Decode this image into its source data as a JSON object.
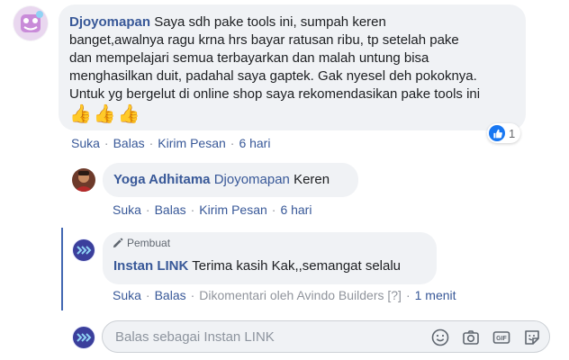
{
  "comments": [
    {
      "author": "Djoyomapan",
      "lines": [
        "Saya sdh pake tools ini, sumpah keren",
        "banget,awalnya ragu krna hrs bayar ratusan ribu, tp setelah pake",
        "dan mempelajari semua terbayarkan dan malah untung bisa",
        "menghasilkan duit, padahal saya gaptek. Gak nyesel deh pokoknya.",
        "Untuk yg bergelut di online shop saya rekomendasikan pake tools ini"
      ],
      "emoji": "👍👍👍",
      "actions": {
        "like": "Suka",
        "reply": "Balas",
        "message": "Kirim Pesan",
        "time": "6 hari"
      },
      "reaction_count": "1"
    }
  ],
  "replies": [
    {
      "author": "Yoga Adhitama",
      "mention": "Djoyomapan",
      "text": " Keren",
      "actions": {
        "like": "Suka",
        "reply": "Balas",
        "message": "Kirim Pesan",
        "time": "6 hari"
      }
    },
    {
      "badge": "Pembuat",
      "author": "Instan LINK",
      "text": "Terima kasih Kak,,semangat selalu",
      "actions": {
        "like": "Suka",
        "reply": "Balas",
        "commented_by": "Dikomentari oleh Avindo Builders",
        "help": "[?]",
        "time": "1 menit"
      }
    }
  ],
  "reply_box": {
    "placeholder": "Balas sebagai Instan LINK"
  },
  "icons": {
    "emoji": "smiley-icon",
    "camera": "camera-icon",
    "gif": "gif-icon",
    "sticker": "sticker-icon",
    "pencil": "pencil-icon",
    "like": "thumbs-up-icon"
  },
  "colors": {
    "link": "#385898",
    "bubble": "#f0f2f5",
    "thread_line": "#4267b2",
    "like_blue": "#1877f2",
    "muted": "#90949c"
  }
}
